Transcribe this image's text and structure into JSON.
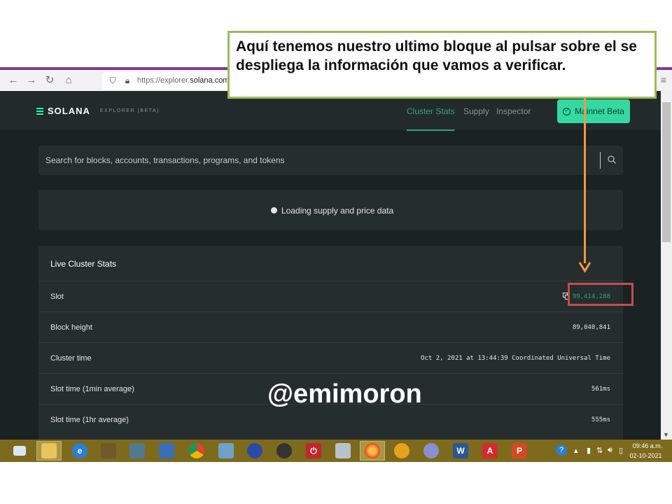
{
  "browser": {
    "url_prefix": "https://explorer.",
    "url_domain": "solana.com"
  },
  "explorer": {
    "logo_text": "SOLANA",
    "logo_sub": "EXPLORER (BETA)",
    "nav": [
      "Cluster Stats",
      "Supply",
      "Inspector"
    ],
    "network_button": "Mainnet Beta",
    "search_placeholder": "Search for blocks, accounts, transactions, programs, and tokens",
    "loading_text": "Loading supply and price data",
    "stats_title": "Live Cluster Stats",
    "stats": [
      {
        "label": "Slot",
        "value": "99,414,288"
      },
      {
        "label": "Block height",
        "value": "89,040,841"
      },
      {
        "label": "Cluster time",
        "value": "Oct 2, 2021 at 13:44:39 Coordinated Universal Time"
      },
      {
        "label": "Slot time (1min average)",
        "value": "561ms"
      },
      {
        "label": "Slot time (1hr average)",
        "value": "555ms"
      }
    ]
  },
  "callout": {
    "text": "Aquí tenemos nuestro ultimo bloque al pulsar sobre el se despliega la información que vamos a verificar."
  },
  "watermark": "@emimoron",
  "taskbar": {
    "time": "09:46 a.m.",
    "date": "02-10-2021"
  },
  "colors": {
    "accent_green": "#33a382",
    "network_button": "#33d9a0",
    "callout_border": "#9bbb59",
    "arrow": "#f79646",
    "highlight": "#c0504d",
    "taskbar": "#7d6a1d"
  }
}
